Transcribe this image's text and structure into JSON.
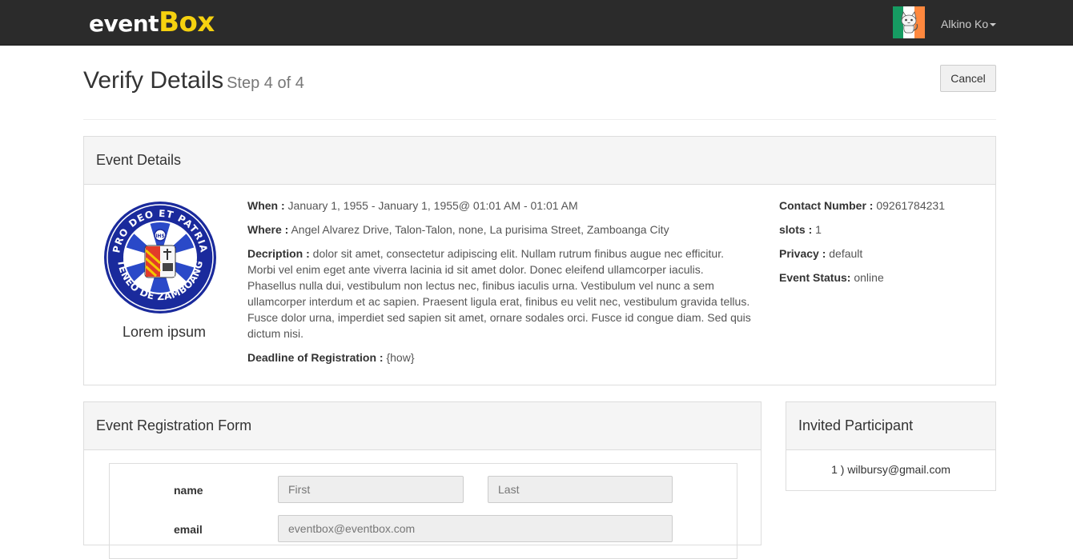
{
  "navbar": {
    "brand_part1": "event",
    "brand_part2": "Box",
    "user_name": "Alkino Ko",
    "avatar_colors": [
      "#169b62",
      "#ffffff",
      "#ff883e"
    ]
  },
  "header": {
    "title": "Verify Details",
    "step": "Step 4 of 4",
    "cancel_label": "Cancel"
  },
  "event_details": {
    "heading": "Event Details",
    "logo_caption": "Lorem ipsum",
    "when_label": "When :",
    "when_value": "January 1, 1955 - January 1, 1955@ 01:01 AM - 01:01 AM",
    "where_label": "Where :",
    "where_value": "Angel Alvarez Drive, Talon-Talon, none, La purisima Street, Zamboanga City",
    "description_label": "Decription :",
    "description_value": "dolor sit amet, consectetur adipiscing elit. Nullam rutrum finibus augue nec efficitur. Morbi vel enim eget ante viverra lacinia id sit amet dolor. Donec eleifend ullamcorper iaculis. Phasellus nulla dui, vestibulum non lectus nec, finibus iaculis urna. Vestibulum vel nunc a sem ullamcorper interdum et ac sapien. Praesent ligula erat, finibus eu velit nec, vestibulum gravida tellus. Fusce dolor urna, imperdiet sed sapien sit amet, ornare sodales orci. Fusce id congue diam. Sed quis dictum nisi.",
    "deadline_label": "Deadline of Registration :",
    "deadline_value": "{how}",
    "contact_label": "Contact Number :",
    "contact_value": "09261784231",
    "slots_label": "slots :",
    "slots_value": "1",
    "privacy_label": "Privacy :",
    "privacy_value": "default",
    "status_label": "Event Status:",
    "status_value": "online"
  },
  "registration_form": {
    "heading": "Event Registration Form",
    "name_label": "name",
    "first_placeholder": "First",
    "last_placeholder": "Last",
    "email_label": "email",
    "email_value": "eventbox@eventbox.com"
  },
  "invited": {
    "heading": "Invited Participant",
    "items": [
      "1 ) wilbursy@gmail.com"
    ]
  }
}
